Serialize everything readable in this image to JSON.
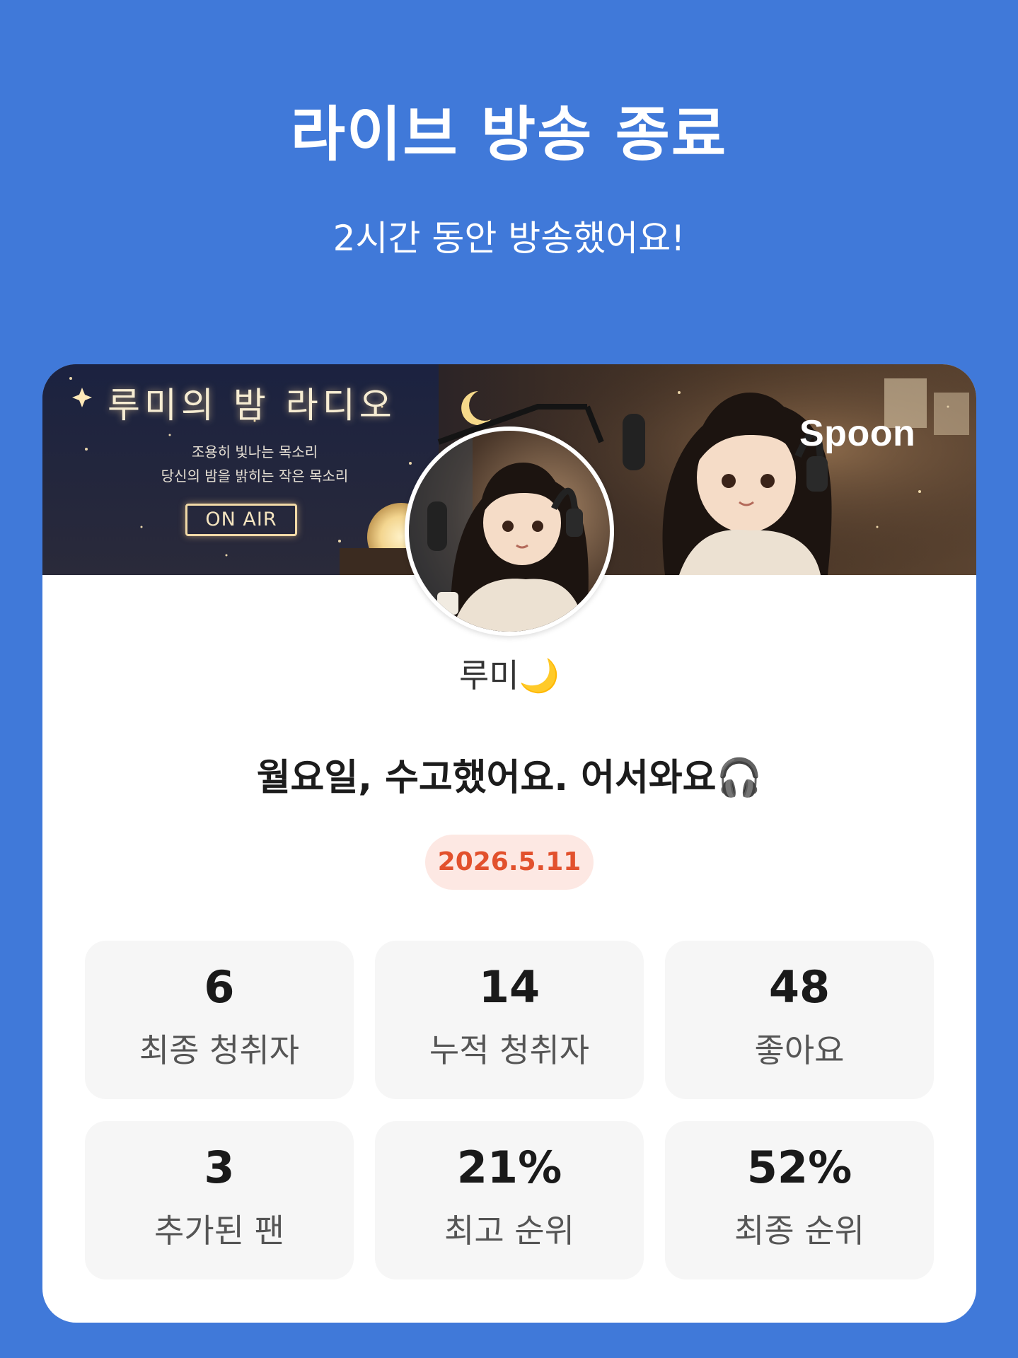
{
  "header": {
    "title": "라이브 방송 종료",
    "subtitle": "2시간 동안 방송했어요!"
  },
  "banner": {
    "title": "루미의 밤 라디오",
    "subtitle_line1": "조용히 빛나는 목소리",
    "subtitle_line2": "당신의 밤을 밝히는 작은 목소리",
    "on_air": "ON AIR",
    "brand": "Spoon"
  },
  "profile": {
    "nickname": "루미🌙"
  },
  "live": {
    "title": "월요일, 수고했어요. 어서와요🎧",
    "date": "2026.5.11"
  },
  "stats": [
    {
      "value": "6",
      "label": "최종 청취자"
    },
    {
      "value": "14",
      "label": "누적 청취자"
    },
    {
      "value": "48",
      "label": "좋아요"
    },
    {
      "value": "3",
      "label": "추가된 팬"
    },
    {
      "value": "21%",
      "label": "최고 순위"
    },
    {
      "value": "52%",
      "label": "최종 순위"
    }
  ],
  "colors": {
    "background": "#4079D9",
    "card": "#FFFFFF",
    "date_pill_bg": "#FDE8E3",
    "date_pill_text": "#E2512D",
    "stat_tile": "#F6F6F6"
  },
  "icons": [
    "moon-icon",
    "headphones-icon"
  ]
}
